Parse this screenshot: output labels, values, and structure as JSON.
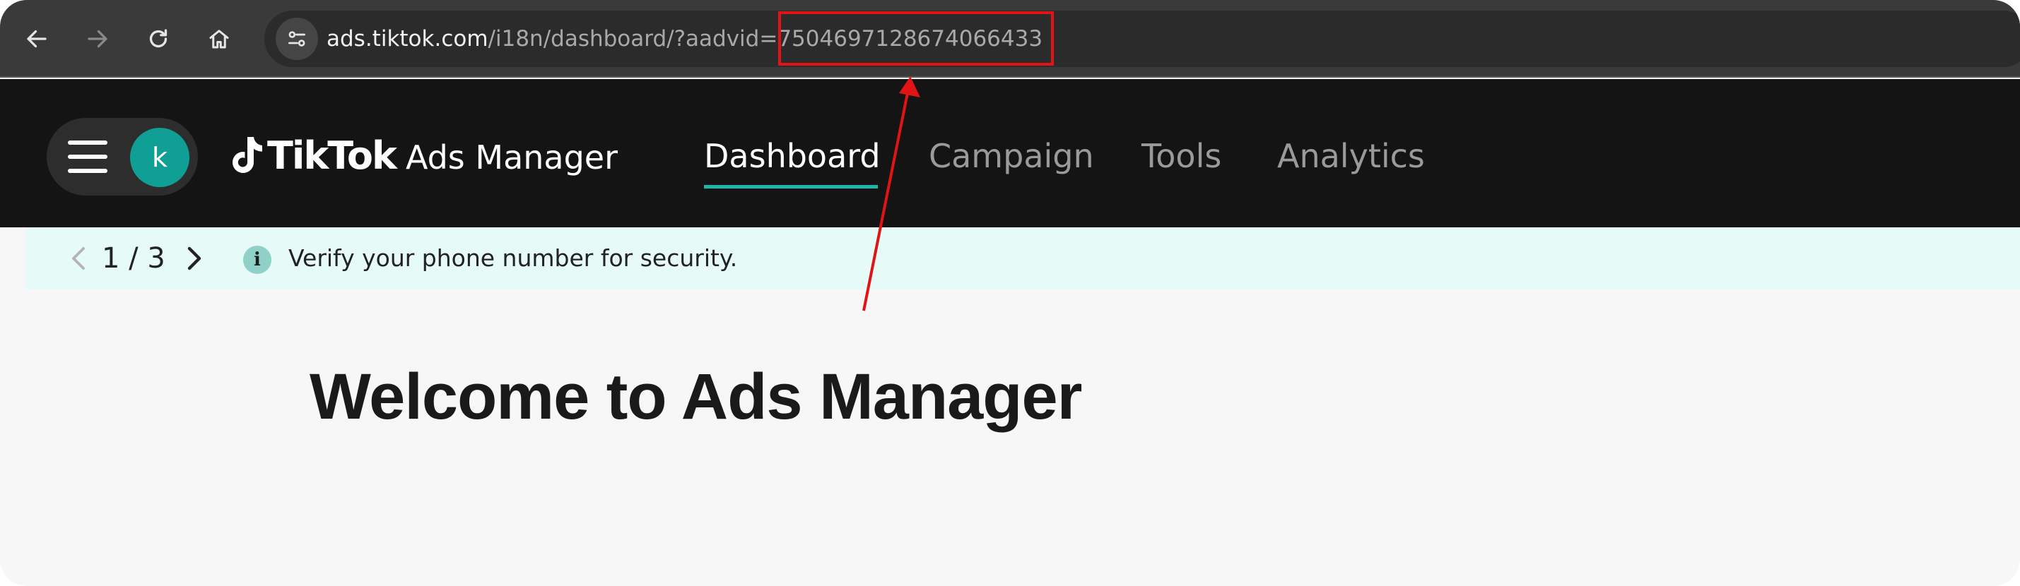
{
  "browser": {
    "back_icon": "arrow-left-icon",
    "forward_icon": "arrow-right-icon",
    "reload_icon": "reload-icon",
    "home_icon": "home-icon",
    "site_info_icon": "tune-icon",
    "url_host": "ads.tiktok.com",
    "url_path": "/i18n/dashboard/?aadvid=",
    "url_param_value": "7504697128674066433"
  },
  "header": {
    "avatar_initial": "k",
    "logo_brand": "TikTok",
    "logo_product": "Ads Manager",
    "tabs": [
      {
        "label": "Dashboard",
        "active": true
      },
      {
        "label": "Campaign",
        "active": false
      },
      {
        "label": "Tools",
        "active": false
      },
      {
        "label": "Analytics",
        "active": false
      }
    ]
  },
  "banner": {
    "pager": "1 / 3",
    "info_icon": "i",
    "message": "Verify your phone number for security."
  },
  "main": {
    "welcome_title": "Welcome to Ads Manager"
  },
  "colors": {
    "accent": "#1fb5a9",
    "avatar": "#0f9f94",
    "banner_bg": "#e6faf8",
    "annotation": "#e01414",
    "header_bg": "#141414"
  }
}
